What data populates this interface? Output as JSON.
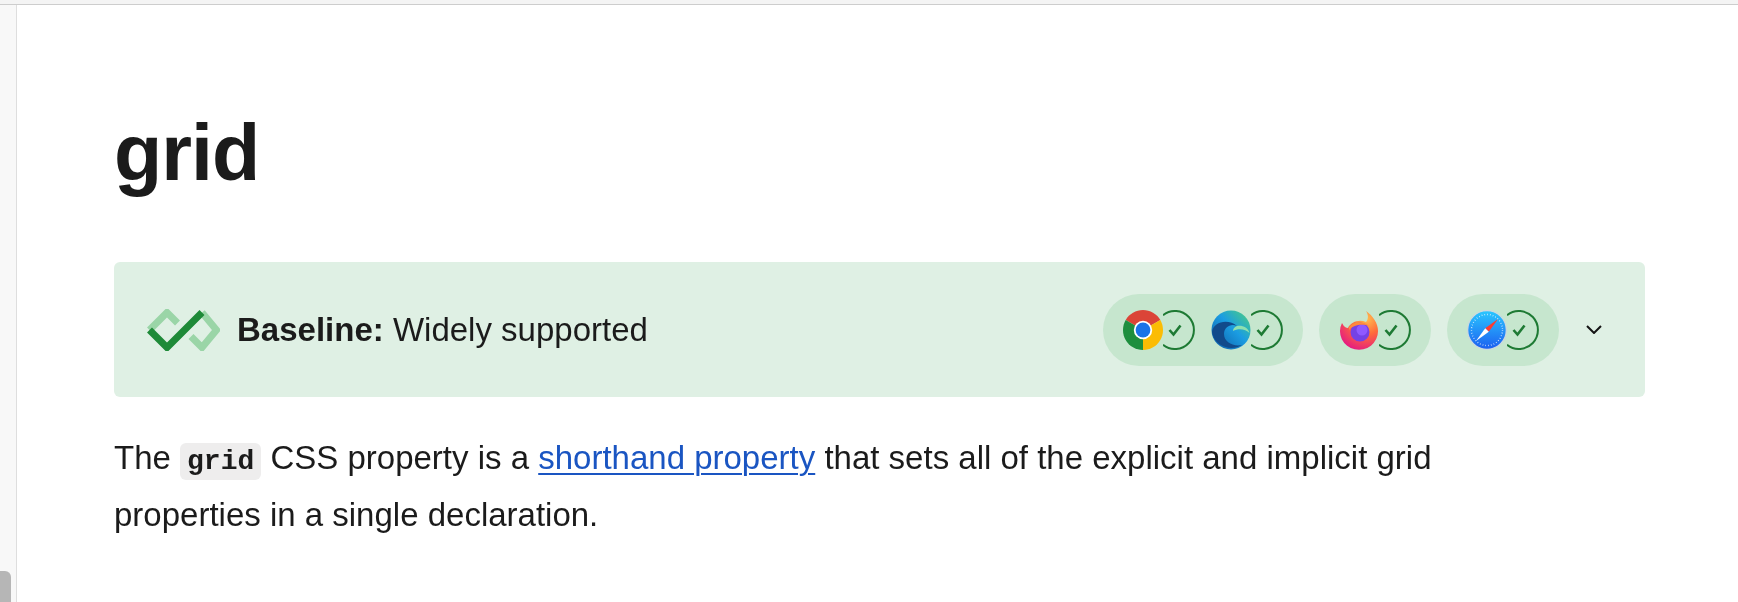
{
  "page": {
    "heading": "grid"
  },
  "baseline": {
    "title": "**Baseline:** Widely supported",
    "expanded": false,
    "engines": [
      {
        "browsers": [
          {
            "kind": "chrome",
            "supported": true
          },
          {
            "kind": "edge",
            "supported": true
          }
        ]
      },
      {
        "browsers": [
          {
            "kind": "firefox",
            "supported": true
          }
        ]
      },
      {
        "browsers": [
          {
            "kind": "safari",
            "supported": true
          }
        ]
      }
    ]
  },
  "description": [
    {
      "kind": "text",
      "text": "The "
    },
    {
      "kind": "code",
      "text": "grid"
    },
    {
      "kind": "text",
      "text": " CSS property is a "
    },
    {
      "kind": "link",
      "text": "shorthand property"
    },
    {
      "kind": "text",
      "text": " that sets all of the explicit and implicit grid properties in a single declaration."
    }
  ]
}
